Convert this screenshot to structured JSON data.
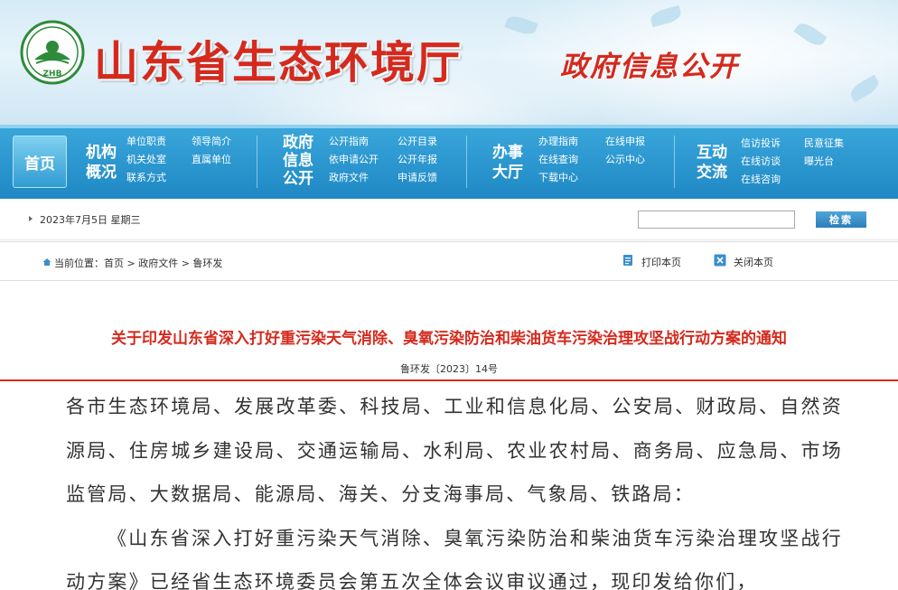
{
  "header": {
    "site_title": "山东省生态环境厅",
    "gov_info": "政府信息公开",
    "logo_text": "ZHB"
  },
  "nav": {
    "home": "首页",
    "groups": [
      {
        "title": "机构\n概况",
        "links": [
          "单位职责",
          "领导简介",
          "机关处室",
          "直属单位",
          "联系方式"
        ]
      },
      {
        "title": "政府\n信息\n公开",
        "links": [
          "公开指南",
          "公开目录",
          "依申请公开",
          "公开年报",
          "政府文件",
          "申请反馈"
        ]
      },
      {
        "title": "办事\n大厅",
        "links": [
          "办理指南",
          "在线申报",
          "在线查询",
          "公示中心",
          "下载中心"
        ]
      },
      {
        "title": "互动\n交流",
        "links": [
          "信访投诉",
          "民意征集",
          "在线访谈",
          "曝光台",
          "在线咨询"
        ]
      }
    ]
  },
  "datebar": {
    "date": "2023年7月5日 星期三",
    "search_placeholder": "",
    "search_button": "检索"
  },
  "breadcrumb": {
    "text": "当前位置：首页 > 政府文件 > 鲁环发",
    "print": "打印本页",
    "close": "关闭本页"
  },
  "article": {
    "title": "关于印发山东省深入打好重污染天气消除、臭氧污染防治和柴油货车污染治理攻坚战行动方案的通知",
    "number": "鲁环发〔2023〕14号",
    "para1": "各市生态环境局、发展改革委、科技局、工业和信息化局、公安局、财政局、自然资源局、住房城乡建设局、交通运输局、水利局、农业农村局、商务局、应急局、市场监管局、大数据局、能源局、海关、分支海事局、气象局、铁路局：",
    "para2": "《山东省深入打好重污染天气消除、臭氧污染防治和柴油货车污染治理攻坚战行动方案》已经省生态环境委员会第五次全体会议审议通过，现印发给你们，"
  },
  "colors": {
    "accent_red": "#d42a1e",
    "nav_blue": "#1f88c4",
    "logo_green": "#2e8b3a"
  }
}
